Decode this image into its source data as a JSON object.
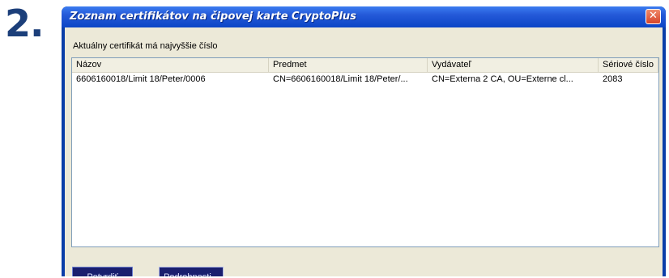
{
  "step_label": "2.",
  "window": {
    "title": "Zoznam certifikátov na čipovej karte CryptoPlus",
    "close_glyph": "✕"
  },
  "info_label": "Aktuálny certifikát má najvyššie číslo",
  "table": {
    "columns": [
      "Názov",
      "Predmet",
      "Vydávateľ",
      "Sériové číslo"
    ],
    "rows": [
      {
        "name": "6606160018/Limit 18/Peter/0006",
        "subject": "CN=6606160018/Limit 18/Peter/...",
        "issuer": "CN=Externa 2 CA, OU=Externe cl...",
        "serial": "2083"
      }
    ]
  },
  "buttons": {
    "confirm": "Potvrdiť",
    "details": "Podrobnosti..."
  },
  "colors": {
    "title_bar": "#0b45c6",
    "dialog_bg": "#ece9d8",
    "button_bg": "#1a1f6e",
    "step_number": "#1c3f7a"
  },
  "icons": {
    "close": "close-icon"
  }
}
